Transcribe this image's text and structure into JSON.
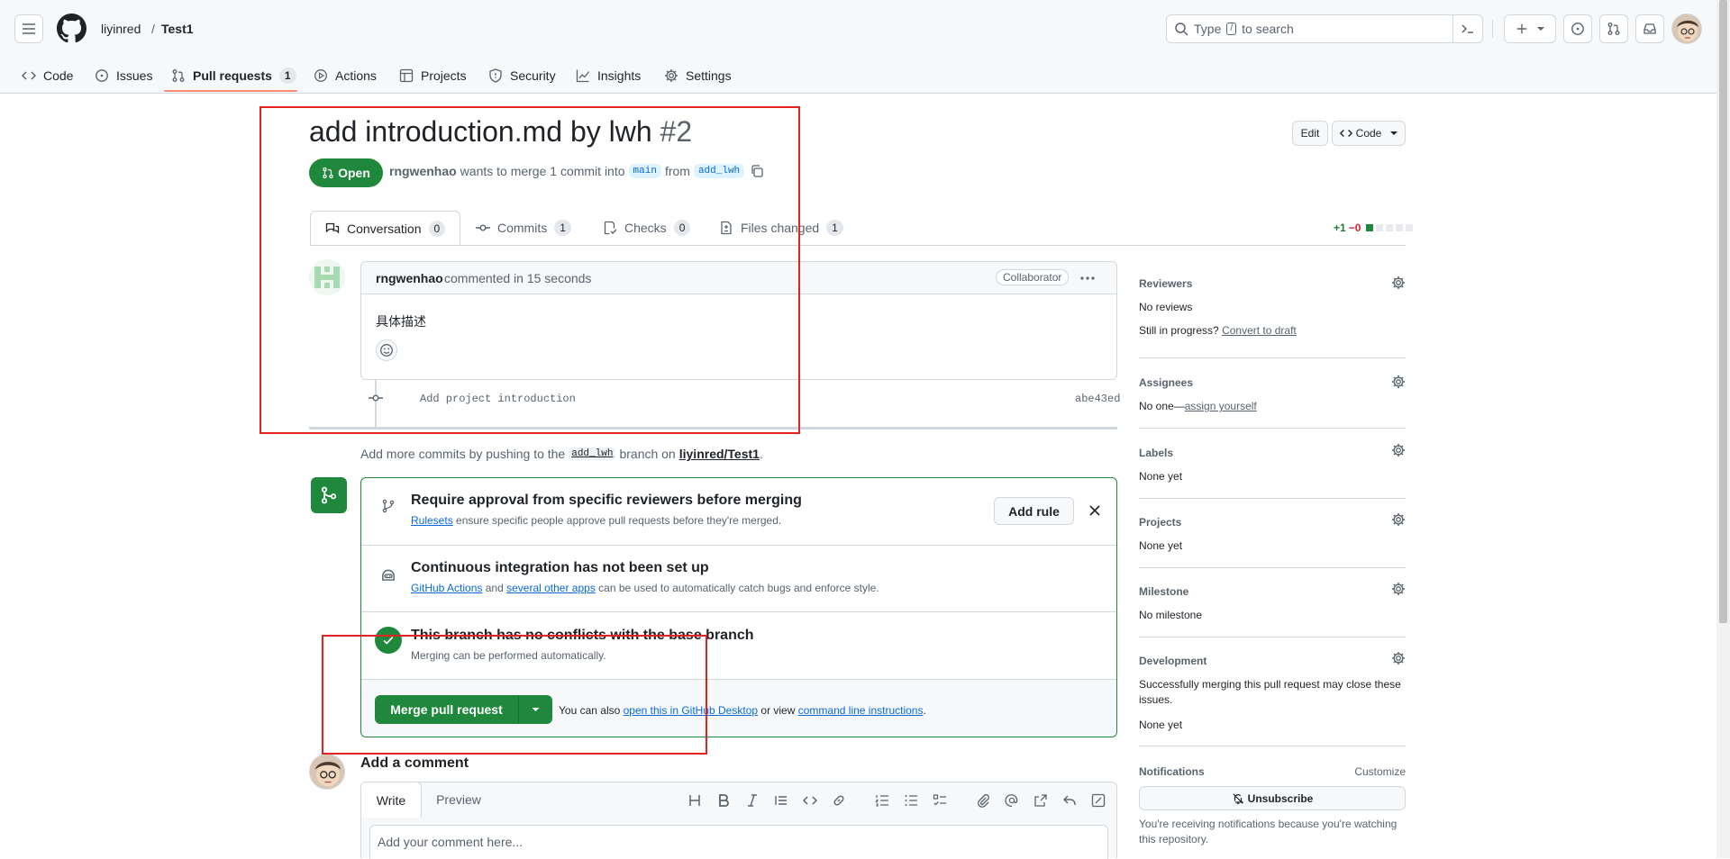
{
  "header": {
    "owner": "liyinred",
    "separator": "/",
    "repo": "Test1",
    "search_prefix": "Type",
    "search_key": "/",
    "search_suffix": "to search"
  },
  "repo_tabs": [
    {
      "label": "Code",
      "icon": "code-icon"
    },
    {
      "label": "Issues",
      "icon": "issue-icon"
    },
    {
      "label": "Pull requests",
      "icon": "pull-request-icon",
      "count": "1"
    },
    {
      "label": "Actions",
      "icon": "play-icon"
    },
    {
      "label": "Projects",
      "icon": "table-icon"
    },
    {
      "label": "Security",
      "icon": "shield-icon"
    },
    {
      "label": "Insights",
      "icon": "graph-icon"
    },
    {
      "label": "Settings",
      "icon": "gear-icon"
    }
  ],
  "pr": {
    "title": "add introduction.md by lwh",
    "number": "#2",
    "state": "Open",
    "author": "rngwenhao",
    "merge_text": "wants to merge 1 commit into",
    "base": "main",
    "from": "from",
    "head": "add_lwh",
    "edit_label": "Edit",
    "code_label": "Code"
  },
  "pr_tabs": [
    {
      "label": "Conversation",
      "count": "0"
    },
    {
      "label": "Commits",
      "count": "1"
    },
    {
      "label": "Checks",
      "count": "0"
    },
    {
      "label": "Files changed",
      "count": "1"
    }
  ],
  "diffstat": {
    "added": "+1",
    "removed": "−0"
  },
  "comment": {
    "author": "rngwenhao",
    "action": "commented in 15 seconds",
    "badge": "Collaborator",
    "body": "具体描述"
  },
  "commit": {
    "message": "Add project introduction",
    "sha": "abe43ed"
  },
  "push_hint": {
    "prefix": "Add more commits by pushing to the",
    "branch": "add_lwh",
    "middle": "branch on",
    "repo": "liyinred/Test1",
    "suffix": "."
  },
  "merge_box": {
    "rule_title": "Require approval from specific reviewers before merging",
    "rule_link": "Rulesets",
    "rule_sub": "ensure specific people approve pull requests before they're merged.",
    "add_rule": "Add rule",
    "ci_title": "Continuous integration has not been set up",
    "ci_link1": "GitHub Actions",
    "ci_and": "and",
    "ci_link2": "several other apps",
    "ci_sub": "can be used to automatically catch bugs and enforce style.",
    "conflict_title": "This branch has no conflicts with the base branch",
    "conflict_sub": "Merging can be performed automatically.",
    "merge_label": "Merge pull request",
    "also_prefix": "You can also",
    "also_link1": "open this in GitHub Desktop",
    "also_mid": "or view",
    "also_link2": "command line instructions",
    "also_suffix": "."
  },
  "add_comment": {
    "heading": "Add a comment",
    "write_tab": "Write",
    "preview_tab": "Preview",
    "placeholder": "Add your comment here..."
  },
  "sidebar": {
    "reviewers": {
      "title": "Reviewers",
      "value": "No reviews",
      "progress": "Still in progress?",
      "draft_link": "Convert to draft"
    },
    "assignees": {
      "title": "Assignees",
      "value": "No one—",
      "link": "assign yourself"
    },
    "labels": {
      "title": "Labels",
      "value": "None yet"
    },
    "projects": {
      "title": "Projects",
      "value": "None yet"
    },
    "milestone": {
      "title": "Milestone",
      "value": "No milestone"
    },
    "development": {
      "title": "Development",
      "desc": "Successfully merging this pull request may close these issues.",
      "value": "None yet"
    },
    "notifications": {
      "title": "Notifications",
      "customize": "Customize",
      "button": "Unsubscribe",
      "note": "You're receiving notifications because you're watching this repository."
    }
  },
  "colors": {
    "accent_green": "#1f883d",
    "link_blue": "#0969da",
    "tab_underline": "#fd8c73",
    "annotation_red": "#e52222"
  }
}
